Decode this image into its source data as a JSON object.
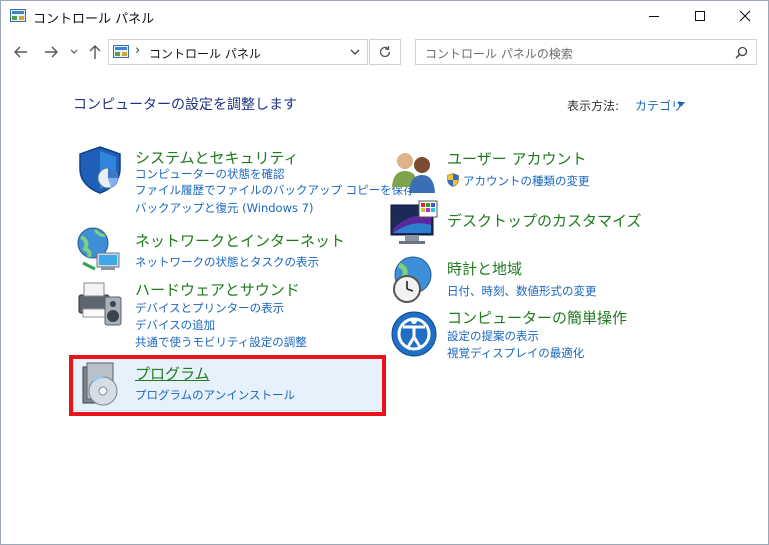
{
  "window": {
    "title": "コントロール パネル"
  },
  "nav": {
    "address_text": "コントロール パネル",
    "address_separator": "›",
    "search_placeholder": "コントロール パネルの検索"
  },
  "header": {
    "heading": "コンピューターの設定を調整します",
    "view_by_label": "表示方法:",
    "view_by_value": "カテゴリ"
  },
  "categories": {
    "system": {
      "title": "システムとセキュリティ",
      "links": [
        "コンピューターの状態を確認",
        "ファイル履歴でファイルのバックアップ コピーを保存",
        "バックアップと復元 (Windows 7)"
      ]
    },
    "network": {
      "title": "ネットワークとインターネット",
      "links": [
        "ネットワークの状態とタスクの表示"
      ]
    },
    "hardware": {
      "title": "ハードウェアとサウンド",
      "links": [
        "デバイスとプリンターの表示",
        "デバイスの追加",
        "共通で使うモビリティ設定の調整"
      ]
    },
    "programs": {
      "title": "プログラム",
      "links": [
        "プログラムのアンインストール"
      ]
    },
    "users": {
      "title": "ユーザー アカウント",
      "links": [
        "アカウントの種類の変更"
      ]
    },
    "appearance": {
      "title": "デスクトップのカスタマイズ",
      "links": []
    },
    "clock": {
      "title": "時計と地域",
      "links": [
        "日付、時刻、数値形式の変更"
      ]
    },
    "ease": {
      "title": "コンピューターの簡単操作",
      "links": [
        "設定の提案の表示",
        "視覚ディスプレイの最適化"
      ]
    }
  },
  "colors": {
    "category_title": "#1f7a1f",
    "link": "#1a66c0",
    "heading": "#1e3287",
    "highlight_bg": "#e6f1fb",
    "annotation_box": "#e8141c"
  },
  "icons": {
    "window": "control-panel-icon",
    "back": "arrow-left-icon",
    "forward": "arrow-right-icon",
    "recent": "chevron-down-icon",
    "up": "arrow-up-icon",
    "refresh": "refresh-icon",
    "search": "search-icon"
  }
}
